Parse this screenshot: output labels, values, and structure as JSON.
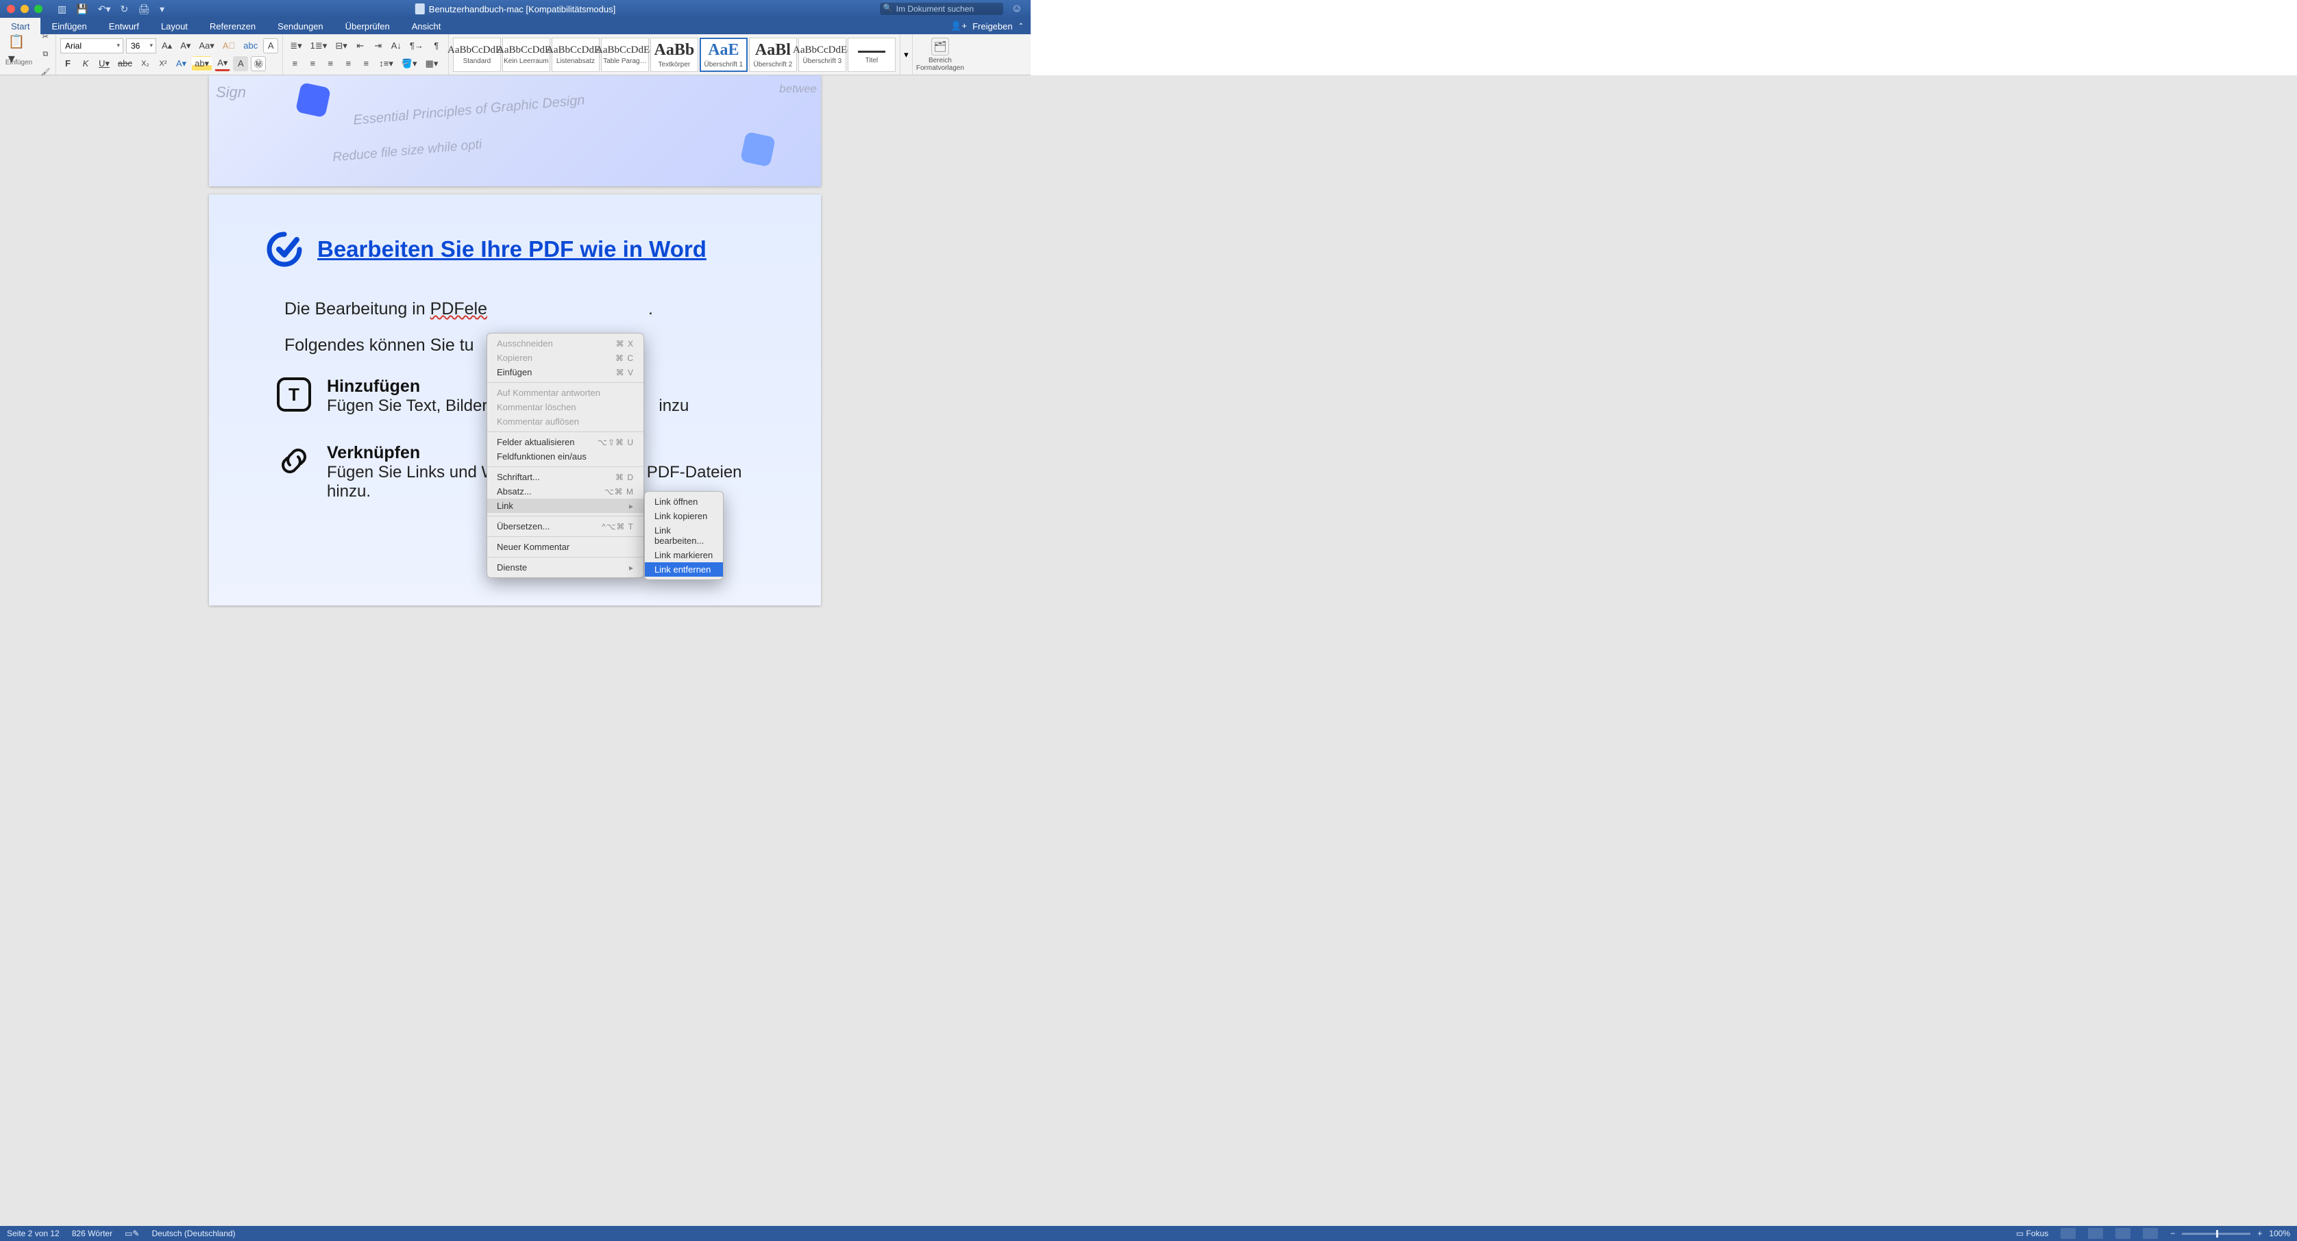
{
  "titlebar": {
    "doc_title": "Benutzerhandbuch-mac [Kompatibilitätsmodus]",
    "search_placeholder": "Im Dokument suchen"
  },
  "tabs": {
    "items": [
      "Start",
      "Einfügen",
      "Entwurf",
      "Layout",
      "Referenzen",
      "Sendungen",
      "Überprüfen",
      "Ansicht"
    ],
    "active_index": 0,
    "share": "Freigeben"
  },
  "ribbon": {
    "paste_label": "Einfügen",
    "font_name": "Arial",
    "font_size": "36",
    "styles": [
      {
        "name": "Standard",
        "sample": "AaBbCcDdEe"
      },
      {
        "name": "Kein Leerraum",
        "sample": "AaBbCcDdEe"
      },
      {
        "name": "Listenabsatz",
        "sample": "AaBbCcDdEe"
      },
      {
        "name": "Table Parag…",
        "sample": "AaBbCcDdEe"
      },
      {
        "name": "Textkörper",
        "sample": "AaBb"
      },
      {
        "name": "Überschrift 1",
        "sample": "AaE"
      },
      {
        "name": "Überschrift 2",
        "sample": "AaBl"
      },
      {
        "name": "Überschrift 3",
        "sample": "AaBbCcDdEe"
      },
      {
        "name": "Titel",
        "sample": ""
      }
    ],
    "selected_style_index": 5,
    "pane_label": "Bereich Formatvorlagen"
  },
  "page1_decor": {
    "line1": "Sign",
    "line2": "Essential Principles of Graphic Design",
    "line3": "Reduce file size while opti",
    "line4": "betwee"
  },
  "doc": {
    "h1": "Bearbeiten Sie Ihre PDF wie in Word",
    "p1_a": "Die Bearbeitung in ",
    "p1_b": "PDFele",
    "p2": "Folgendes können Sie tu",
    "feat1_title": "Hinzufügen",
    "feat1_body": "Fügen Sie Text, Bilder",
    "feat1_tail": "inzu",
    "feat2_title": "Verknüpfen",
    "feat2_body": "Fügen Sie Links und W",
    "feat2_tail": " PDF-Dateien hinzu.",
    "p1_tail": "."
  },
  "ctx": {
    "items": [
      {
        "label": "Ausschneiden",
        "sc": "⌘ X",
        "dis": true
      },
      {
        "label": "Kopieren",
        "sc": "⌘ C",
        "dis": true
      },
      {
        "label": "Einfügen",
        "sc": "⌘ V",
        "dis": false
      },
      {
        "sep": true
      },
      {
        "label": "Auf Kommentar antworten",
        "dis": true
      },
      {
        "label": "Kommentar löschen",
        "dis": true
      },
      {
        "label": "Kommentar auflösen",
        "dis": true
      },
      {
        "sep": true
      },
      {
        "label": "Felder aktualisieren",
        "sc": "⌥⇧⌘ U",
        "dis": false
      },
      {
        "label": "Feldfunktionen ein/aus",
        "dis": false
      },
      {
        "sep": true
      },
      {
        "label": "Schriftart...",
        "sc": "⌘ D",
        "dis": false
      },
      {
        "label": "Absatz...",
        "sc": "⌥⌘ M",
        "dis": false
      },
      {
        "label": "Link",
        "sub": true,
        "hov": true
      },
      {
        "sep": true
      },
      {
        "label": "Übersetzen...",
        "sc": "^⌥⌘ T",
        "dis": false
      },
      {
        "sep": true
      },
      {
        "label": "Neuer Kommentar",
        "dis": false
      },
      {
        "sep": true
      },
      {
        "label": "Dienste",
        "sub": true
      }
    ],
    "submenu": [
      {
        "label": "Link öffnen"
      },
      {
        "label": "Link kopieren"
      },
      {
        "label": "Link bearbeiten..."
      },
      {
        "label": "Link markieren"
      },
      {
        "label": "Link entfernen",
        "sel": true
      }
    ]
  },
  "status": {
    "page": "Seite 2 von 12",
    "words": "826 Wörter",
    "lang": "Deutsch (Deutschland)",
    "focus": "Fokus",
    "zoom": "100%"
  }
}
